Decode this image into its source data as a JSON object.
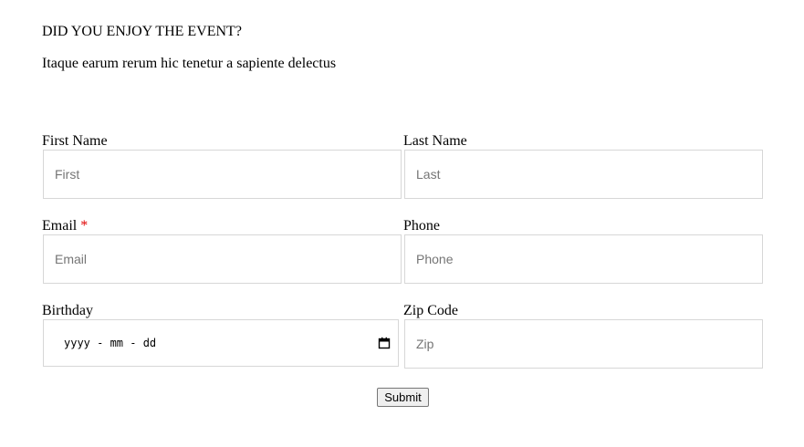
{
  "header": {
    "title": "DID YOU ENJOY THE EVENT?",
    "subtitle": "Itaque earum rerum hic tenetur a sapiente delectus"
  },
  "form": {
    "first_name": {
      "label": "First Name",
      "placeholder": "First"
    },
    "last_name": {
      "label": "Last Name",
      "placeholder": "Last"
    },
    "email": {
      "label": "Email",
      "required_marker": "*",
      "placeholder": "Email"
    },
    "phone": {
      "label": "Phone",
      "placeholder": "Phone"
    },
    "birthday": {
      "label": "Birthday",
      "placeholder": "yyyy - mm - dd",
      "icon": "calendar-icon"
    },
    "zip": {
      "label": "Zip Code",
      "placeholder": "Zip"
    },
    "submit_label": "Submit"
  }
}
